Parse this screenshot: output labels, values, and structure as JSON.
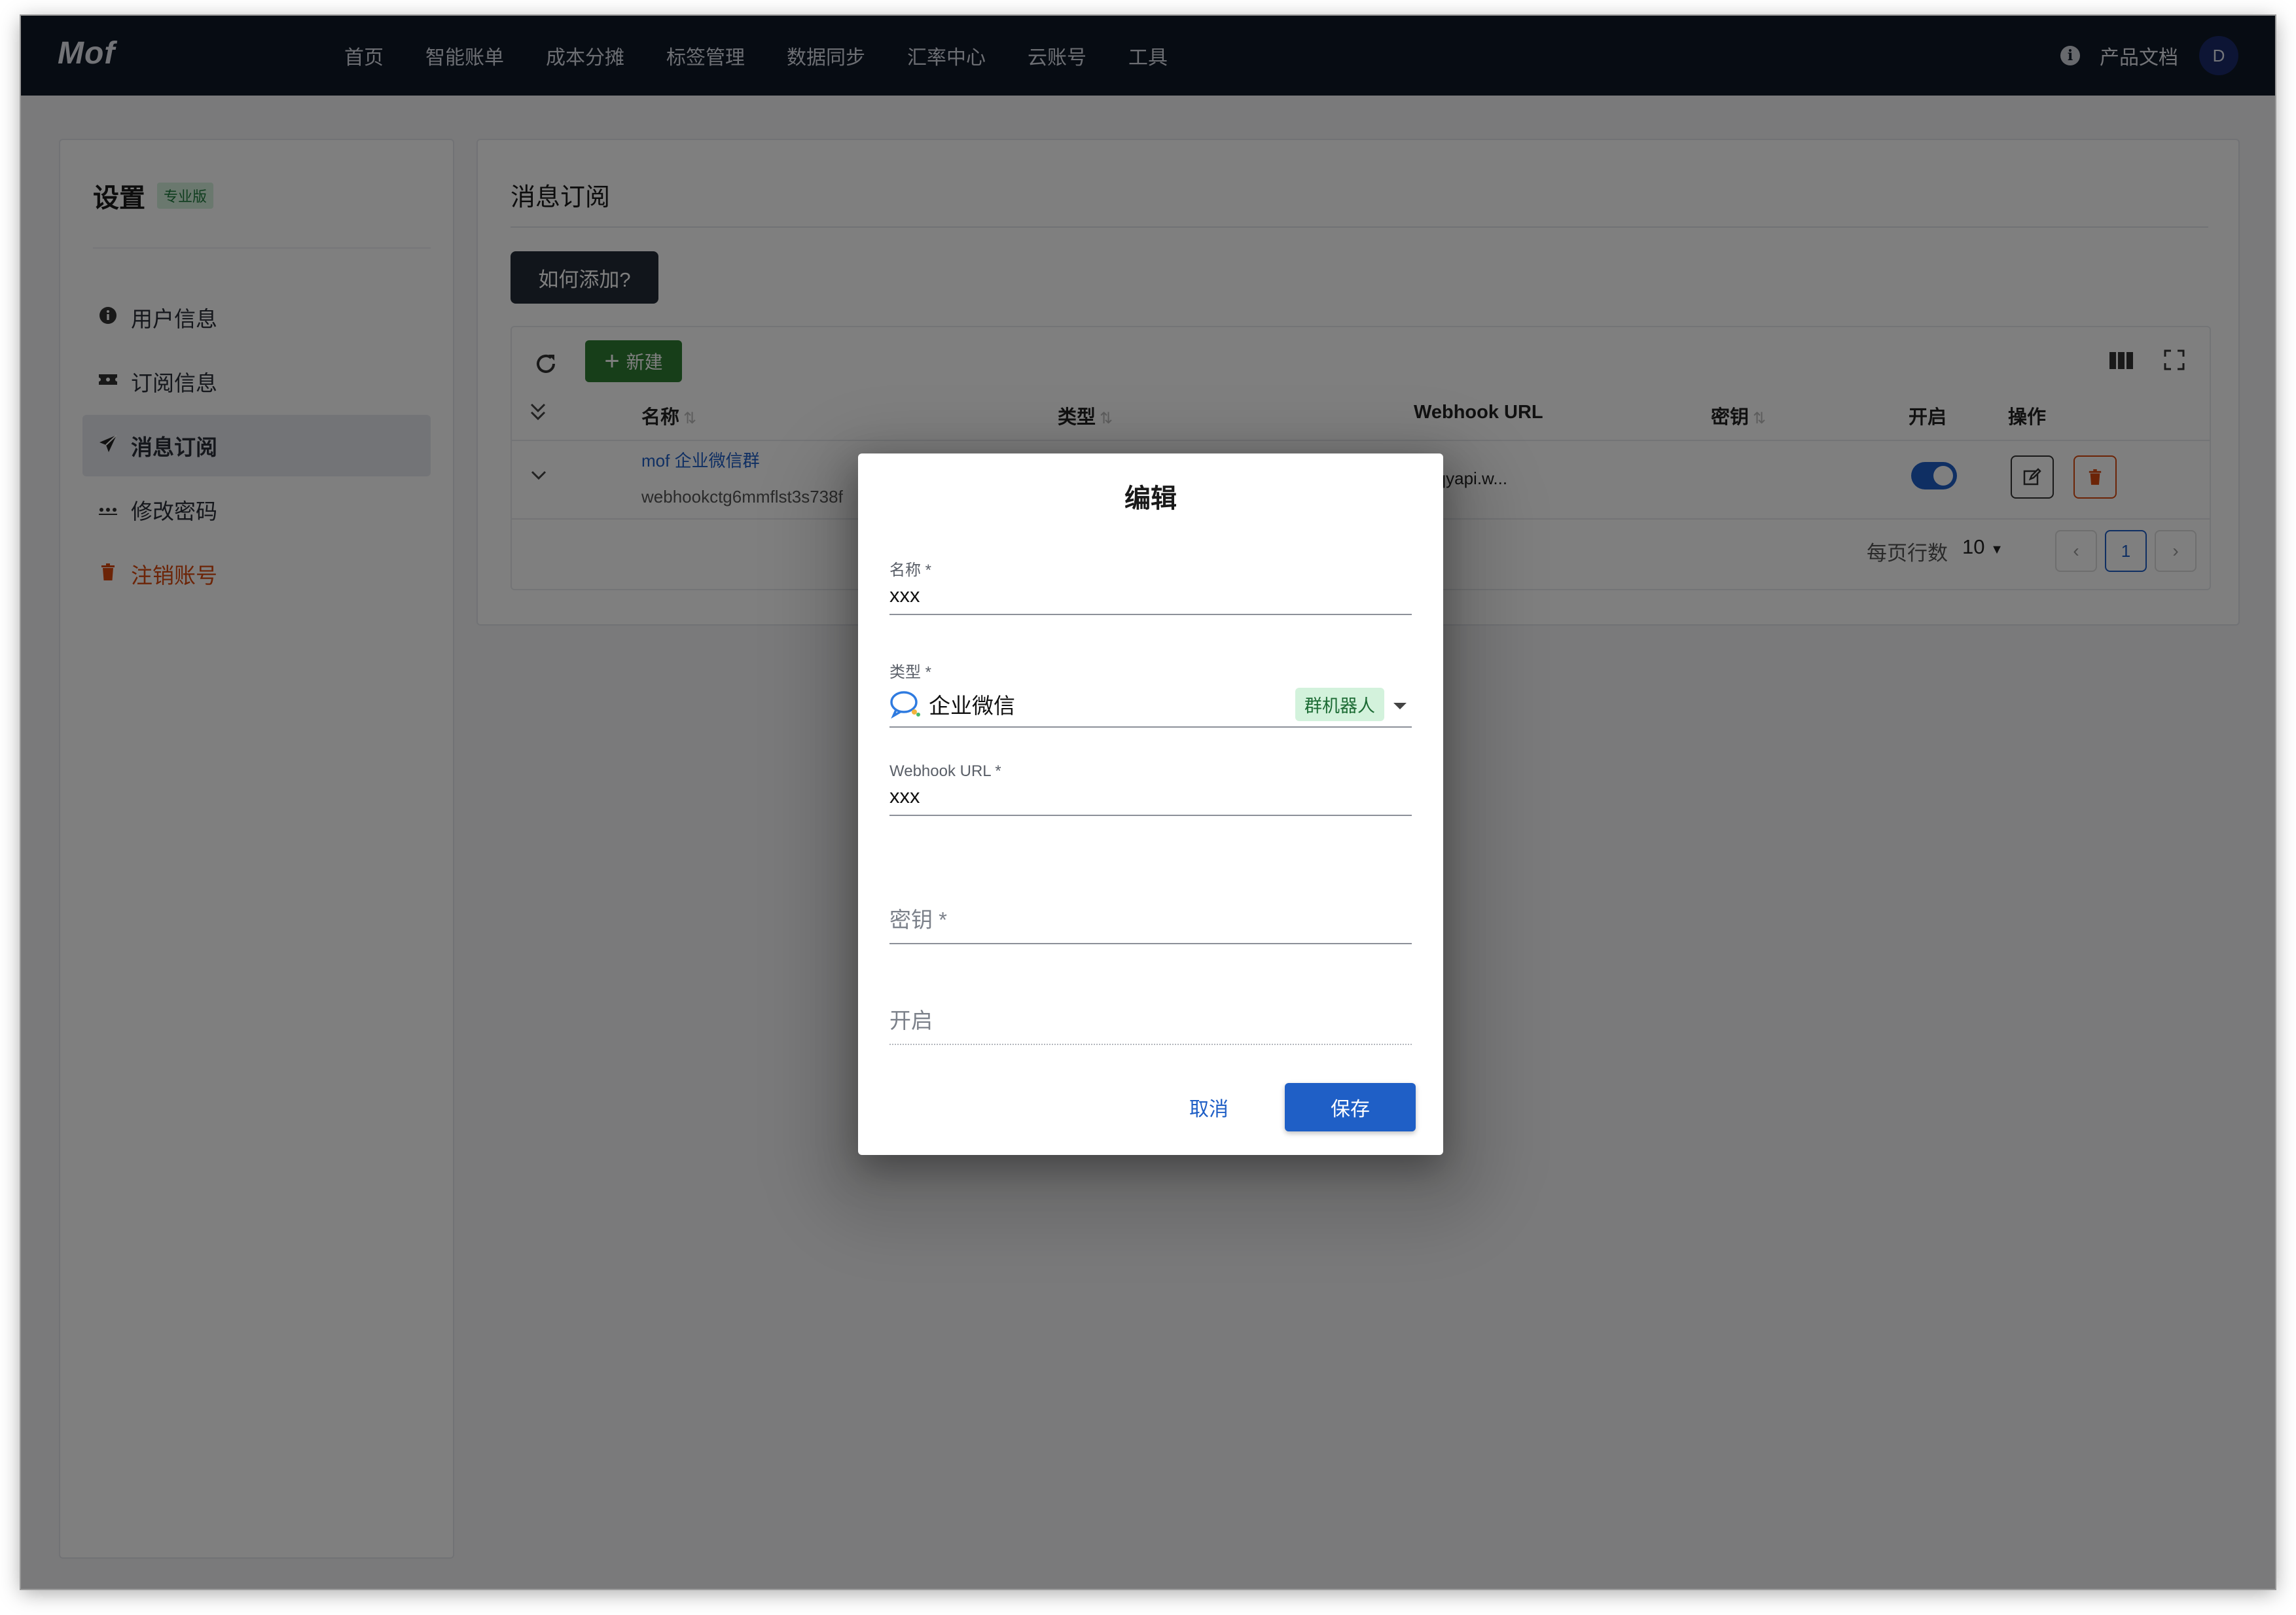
{
  "app": {
    "logo": "Mof"
  },
  "topnav": {
    "items": [
      "首页",
      "智能账单",
      "成本分摊",
      "标签管理",
      "数据同步",
      "汇率中心",
      "云账号",
      "工具"
    ],
    "docs_label": "产品文档",
    "avatar_initial": "D"
  },
  "sidebar": {
    "title": "设置",
    "badge": "专业版",
    "items": [
      {
        "label": "用户信息",
        "icon": "info-circle-icon"
      },
      {
        "label": "订阅信息",
        "icon": "ticket-icon"
      },
      {
        "label": "消息订阅",
        "icon": "send-icon",
        "active": true
      },
      {
        "label": "修改密码",
        "icon": "password-dots-icon"
      },
      {
        "label": "注销账号",
        "icon": "trash-icon",
        "danger": true
      }
    ]
  },
  "main": {
    "title": "消息订阅",
    "how_button": "如何添加?",
    "new_button": "新建",
    "columns": [
      "名称",
      "类型",
      "Webhook URL",
      "密钥",
      "开启",
      "操作"
    ],
    "rows": [
      {
        "name": "mof 企业微信群",
        "name_sub": "webhookctg6mmflst3s738f",
        "webhook": "s://qyapi.w...",
        "enabled": true
      }
    ],
    "pagination": {
      "rows_per_page_label": "每页行数",
      "rows_per_page": "10",
      "current_page": "1"
    }
  },
  "dialog": {
    "title": "编辑",
    "name_label": "名称 *",
    "name_value": "xxx",
    "type_label": "类型 *",
    "type_value": "企业微信",
    "type_chip": "群机器人",
    "webhook_label": "Webhook URL *",
    "webhook_value": "xxx",
    "secret_placeholder": "密钥 *",
    "enabled_placeholder": "开启",
    "cancel_label": "取消",
    "save_label": "保存"
  },
  "colors": {
    "nav_bg": "#0f1826",
    "primary": "#1f5fc6",
    "success": "#2e7d32",
    "danger": "#d9480f"
  }
}
